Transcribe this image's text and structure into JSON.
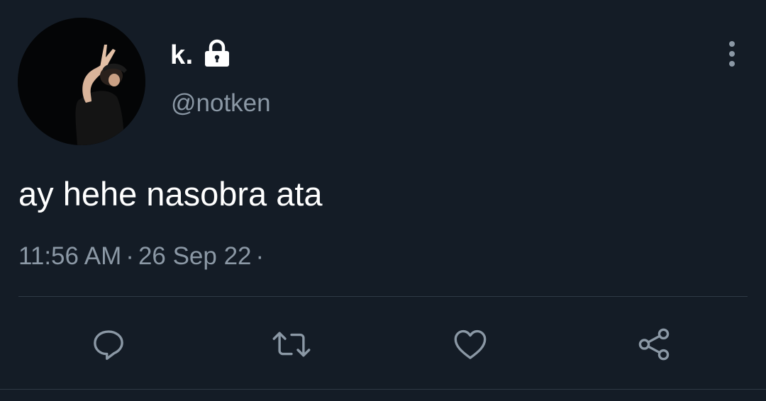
{
  "user": {
    "display_name": "k.",
    "handle": "@notken",
    "avatar_icon": "profile-photo",
    "protected_icon": "lock-icon"
  },
  "tweet": {
    "text": "ay hehe nasobra ata",
    "time": "11:56 AM",
    "separator": "·",
    "date": "26 Sep 22",
    "trailing_separator": "·"
  },
  "actions": {
    "reply_icon": "reply-icon",
    "retweet_icon": "retweet-icon",
    "like_icon": "heart-icon",
    "share_icon": "share-icon"
  },
  "menu": {
    "more_icon": "more-vertical-icon"
  },
  "colors": {
    "background": "#141c26",
    "primary_text": "#ffffff",
    "secondary_text": "#8b98a5",
    "divider": "#2f3a45"
  }
}
